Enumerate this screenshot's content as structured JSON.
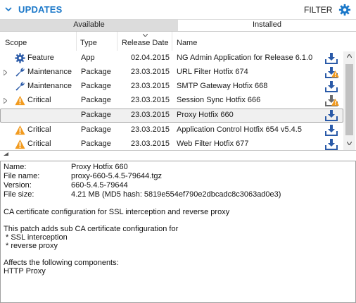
{
  "header": {
    "title": "UPDATES",
    "filter_label": "FILTER",
    "accent": "#1b78c9"
  },
  "tabs": {
    "available": "Available",
    "installed": "Installed"
  },
  "columns": {
    "scope": "Scope",
    "type": "Type",
    "release_date": "Release Date",
    "name": "Name"
  },
  "rows": [
    {
      "scope": "Feature",
      "scope_icon": "gear-icon",
      "type": "App",
      "date": "02.04.2015",
      "name": "NG Admin Application for Release 6.1.0",
      "expander": false,
      "download_warning": false
    },
    {
      "scope": "Maintenance",
      "scope_icon": "wrench-icon",
      "type": "Package",
      "date": "23.03.2015",
      "name": "URL Filter Hotfix 674",
      "expander": true,
      "download_warning": true
    },
    {
      "scope": "Maintenance",
      "scope_icon": "wrench-icon",
      "type": "Package",
      "date": "23.03.2015",
      "name": "SMTP Gateway Hotfix 668",
      "expander": false,
      "download_warning": false
    },
    {
      "scope": "Critical",
      "scope_icon": "warning-icon",
      "type": "Package",
      "date": "23.03.2015",
      "name": "Session Sync Hotfix 666",
      "expander": true,
      "download_warning": true
    },
    {
      "scope": "",
      "scope_icon": "",
      "type": "Package",
      "date": "23.03.2015",
      "name": "Proxy Hotfix 660",
      "expander": false,
      "download_warning": false,
      "selected": true
    },
    {
      "scope": "Critical",
      "scope_icon": "warning-icon",
      "type": "Package",
      "date": "23.03.2015",
      "name": "Application Control Hotfix 654 v5.4.5",
      "expander": false,
      "download_warning": false
    },
    {
      "scope": "Critical",
      "scope_icon": "warning-icon",
      "type": "Package",
      "date": "23.03.2015",
      "name": "Web Filter Hotfix 677",
      "expander": false,
      "download_warning": false
    }
  ],
  "details": {
    "name_label": "Name:",
    "name_value": "Proxy Hotfix 660",
    "file_label": "File name:",
    "file_value": "proxy-660-5.4.5-79644.tgz",
    "version_label": "Version:",
    "version_value": "660-5.4.5-79644",
    "size_label": "File size:",
    "size_value": "4.21 MB  (MD5 hash: 5819e554ef790e2dbcadc8c3063ad0e3)",
    "summary": "CA certificate configuration for SSL interception and reverse proxy",
    "description": "This patch adds sub CA certificate configuration for\n * SSL interception\n * reverse proxy",
    "affects_label": "Affects the following components:",
    "affects_value": "HTTP Proxy"
  }
}
